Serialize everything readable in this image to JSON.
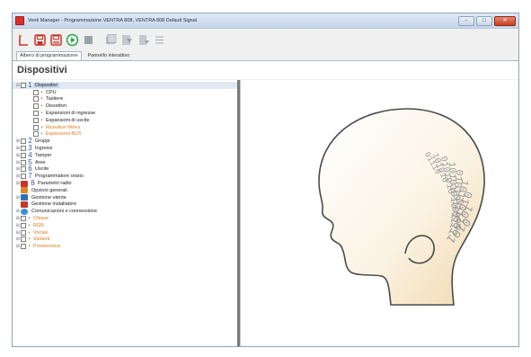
{
  "window": {
    "title": "Venti Manager - Programmazione VENTRA 808, VENTRA 808 Default Signal",
    "controls": {
      "minimize": "–",
      "maximize": "□",
      "close": "✕"
    }
  },
  "toolbar": {
    "icons": [
      "new-icon",
      "open-icon",
      "save-icon",
      "connect-icon",
      "stop-icon",
      "read-icon",
      "write-icon",
      "send-icon",
      "list-icon"
    ]
  },
  "tabs": [
    {
      "label": "Albero di programmazione",
      "active": true
    },
    {
      "label": "Pannello interattivo",
      "active": false
    }
  ],
  "section_title": "Dispositivi",
  "tree": [
    {
      "level": 0,
      "expander": "⊟",
      "num": "1",
      "label": "Dispositivi",
      "style": "normal",
      "selected": true
    },
    {
      "level": 1,
      "dot": "•",
      "label": "CPU",
      "style": "normal"
    },
    {
      "level": 1,
      "dot": "•",
      "label": "Tastiere",
      "style": "normal"
    },
    {
      "level": 1,
      "dot": "•",
      "label": "Dissettori",
      "style": "normal"
    },
    {
      "level": 1,
      "dot": "•",
      "label": "Espansioni di ingresse",
      "style": "normal"
    },
    {
      "level": 1,
      "dot": "•",
      "label": "Espansioni di uscite",
      "style": "normal"
    },
    {
      "level": 1,
      "dot": "•",
      "label": "Ricevitori Wires",
      "style": "orange"
    },
    {
      "level": 1,
      "dot": "•",
      "label": "Espansioni BUS",
      "style": "orange"
    },
    {
      "level": 0,
      "expander": "⊞",
      "num": "2",
      "label": "Gruppi",
      "style": "normal"
    },
    {
      "level": 0,
      "expander": "⊞",
      "num": "3",
      "label": "Ingressi",
      "style": "normal"
    },
    {
      "level": 0,
      "expander": "⊞",
      "num": "4",
      "label": "Tamper",
      "style": "normal"
    },
    {
      "level": 0,
      "expander": "⊞",
      "num": "5",
      "label": "Aree",
      "style": "normal"
    },
    {
      "level": 0,
      "expander": "⊞",
      "num": "6",
      "label": "Uscite",
      "style": "normal"
    },
    {
      "level": 0,
      "expander": "⊞",
      "num": "7",
      "label": "Programmatore orario",
      "style": "normal"
    },
    {
      "level": 0,
      "expander": "⊞",
      "num": "8",
      "label": "Parametri radio",
      "style": "normal",
      "icon": "radio-icon"
    },
    {
      "level": 0,
      "label": "Opzioni generali",
      "style": "normal",
      "icon": "options-icon"
    },
    {
      "level": 0,
      "expander": "⊞",
      "label": "Gestione utente",
      "style": "normal",
      "icon": "user-icon"
    },
    {
      "level": 0,
      "label": "Gestione installatore",
      "style": "normal",
      "icon": "installer-icon"
    },
    {
      "level": 0,
      "expander": "⊞",
      "label": "Comunicazioni e connessione",
      "style": "normal",
      "icon": "globe-icon"
    },
    {
      "level": 0,
      "expander": "⊞",
      "dot": "•",
      "label": "Chiave",
      "style": "orange"
    },
    {
      "level": 0,
      "expander": "⊞",
      "dot": "•",
      "label": "RGB",
      "style": "orange"
    },
    {
      "level": 0,
      "expander": "⊞",
      "dot": "•",
      "label": "Vocale",
      "style": "orange"
    },
    {
      "level": 0,
      "expander": "⊞",
      "dot": "•",
      "label": "Varianti",
      "style": "orange"
    },
    {
      "level": 0,
      "expander": "⊞",
      "dot": "•",
      "label": "Promemoria",
      "style": "orange"
    }
  ],
  "illustration": {
    "icon": "binary-head-icon",
    "binary_rows": [
      "01110",
      "101010",
      "0101010",
      "10101010",
      "01010101",
      "1010101",
      "010101",
      "10101",
      "0101"
    ]
  },
  "colors": {
    "accent": "#e07b1c",
    "number": "#2e5aa8",
    "title_red": "#d9302b"
  }
}
